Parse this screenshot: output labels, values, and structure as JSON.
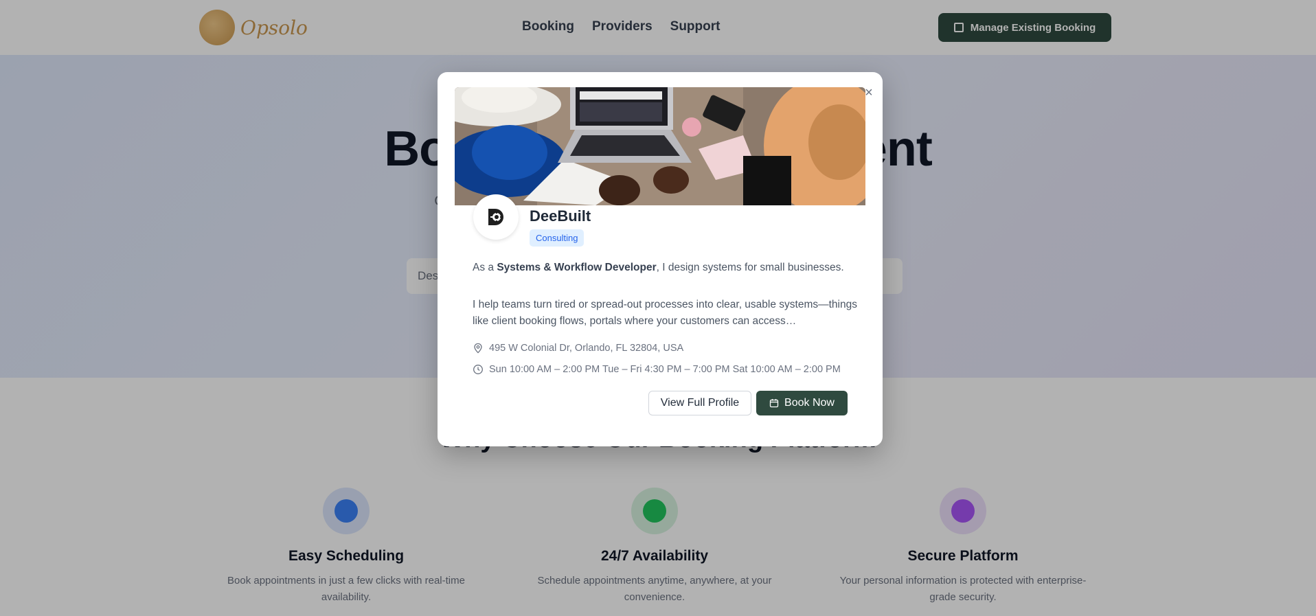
{
  "nav": {
    "logo_text": "Opsolo",
    "links": [
      "Booking",
      "Providers",
      "Support"
    ],
    "manage_label": "Manage Existing Booking"
  },
  "hero": {
    "title": "Book Your Appointment",
    "subtitle": "Connect with trusted providers and schedule your appointment in minutes",
    "search_placeholder": "Desk..."
  },
  "why": {
    "title": "Why Choose Our Booking Platform",
    "features": [
      {
        "title": "Easy Scheduling",
        "desc": "Book appointments in just a few clicks with real-time availability.",
        "icon": "calendar-icon",
        "color": "#3b82f6"
      },
      {
        "title": "24/7 Availability",
        "desc": "Schedule appointments anytime, anywhere, at your convenience.",
        "icon": "clock-icon",
        "color": "#22c55e"
      },
      {
        "title": "Secure Platform",
        "desc": "Your personal information is protected with enterprise-grade security.",
        "icon": "shield-icon",
        "color": "#a855f7"
      }
    ]
  },
  "modal": {
    "close_label": "×",
    "provider_name": "DeeBuilt",
    "category": "Consulting",
    "desc1_prefix": "As a ",
    "desc1_bold": "Systems & Workflow Developer",
    "desc1_suffix": ", I design systems for small businesses.",
    "desc2": "I help teams turn tired or spread-out processes into clear, usable systems—things like client booking flows, portals where your customers can access…",
    "address": "495 W Colonial Dr, Orlando, FL 32804, USA",
    "hours": "Sun 10:00 AM – 2:00 PM Tue – Fri 4:30 PM – 7:00 PM Sat 10:00 AM – 2:00 PM",
    "view_profile_label": "View Full Profile",
    "book_now_label": "Book Now"
  },
  "colors": {
    "primary_dark_green": "#2f4a3f",
    "badge_bg": "#e0efff",
    "badge_text": "#2563eb"
  }
}
